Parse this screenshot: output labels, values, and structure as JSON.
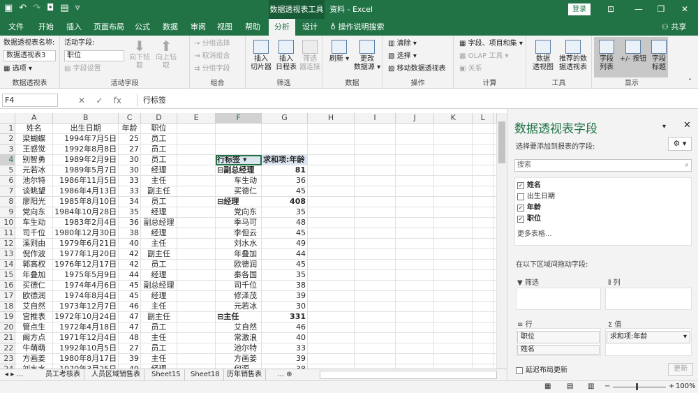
{
  "titlebar": {
    "context_tool": "数据透视表工具",
    "title": "资料 - Excel",
    "login": "登录"
  },
  "tabs": [
    "文件",
    "开始",
    "插入",
    "页面布局",
    "公式",
    "数据",
    "审阅",
    "视图",
    "帮助",
    "分析",
    "设计"
  ],
  "active_tab": "分析",
  "tell_me": "操作说明搜索",
  "share": "共享",
  "ribbon": {
    "pt_name_label": "数据透视表名称:",
    "pt_name_value": "数据透视表3",
    "options": "选项",
    "group_pivottable": "数据透视表",
    "active_field_label": "活动字段:",
    "active_field_value": "职位",
    "field_settings": "字段设置",
    "drill_down": "向下钻取",
    "drill_up": "向上钻",
    "drill_up2": "取",
    "group_active_field": "活动字段",
    "group_selection": "分组选择",
    "ungroup": "取消组合",
    "group_field": "分组字段",
    "group_group": "组合",
    "insert_slicer": "插入",
    "insert_slicer2": "切片器",
    "insert_timeline": "插入",
    "insert_timeline2": "日程表",
    "filter_conn": "筛选",
    "filter_conn2": "器连接",
    "group_filter": "筛选",
    "refresh": "刷新",
    "change_source": "更改",
    "change_source2": "数据源",
    "group_data": "数据",
    "clear": "清除",
    "select": "选择",
    "move_pt": "移动数据透视表",
    "group_actions": "操作",
    "fields_items_sets": "字段、项目和集",
    "olap_tools": "OLAP 工具",
    "relationships": "关系",
    "group_calc": "计算",
    "pivotchart": "数据",
    "pivotchart2": "透视图",
    "recommended": "推荐的数",
    "recommended2": "据透视表",
    "group_tools": "工具",
    "field_list": "字段",
    "field_list2": "列表",
    "pm_buttons": "+/- 按钮",
    "field_headers": "字段",
    "field_headers2": "标题",
    "group_show": "显示"
  },
  "namebox": "F4",
  "formula": "行标签",
  "columns": [
    "A",
    "B",
    "C",
    "D",
    "E",
    "F",
    "G",
    "H",
    "I",
    "J",
    "K",
    "L"
  ],
  "source_header": [
    "姓名",
    "出生日期",
    "年龄",
    "职位"
  ],
  "source_rows": [
    [
      "梁蝴蝶",
      "1994年7月5日",
      "25",
      "员工"
    ],
    [
      "王感觉",
      "1992年8月8日",
      "27",
      "员工"
    ],
    [
      "别智勇",
      "1989年2月9日",
      "30",
      "员工"
    ],
    [
      "元若冰",
      "1989年5月7日",
      "30",
      "经理"
    ],
    [
      "池尔特",
      "1986年11月5日",
      "33",
      "主任"
    ],
    [
      "谈眺望",
      "1986年4月13日",
      "33",
      "副主任"
    ],
    [
      "廖阳光",
      "1985年8月10日",
      "34",
      "员工"
    ],
    [
      "党向东",
      "1984年10月28日",
      "35",
      "经理"
    ],
    [
      "车生动",
      "1983年2月4日",
      "36",
      "副总经理"
    ],
    [
      "司千位",
      "1980年12月30日",
      "38",
      "经理"
    ],
    [
      "溪则由",
      "1979年6月21日",
      "40",
      "主任"
    ],
    [
      "倪作波",
      "1977年1月20日",
      "42",
      "副主任"
    ],
    [
      "郭高权",
      "1976年12月17日",
      "42",
      "员工"
    ],
    [
      "年叠加",
      "1975年5月9日",
      "44",
      "经理"
    ],
    [
      "买德仁",
      "1974年4月6日",
      "45",
      "副总经理"
    ],
    [
      "欧德润",
      "1974年8月4日",
      "45",
      "经理"
    ],
    [
      "艾自然",
      "1973年12月7日",
      "46",
      "主任"
    ],
    [
      "宫推表",
      "1972年10月24日",
      "47",
      "副主任"
    ],
    [
      "管点生",
      "1972年4月18日",
      "47",
      "员工"
    ],
    [
      "阚方点",
      "1971年12月4日",
      "48",
      "主任"
    ],
    [
      "牛萌萌",
      "1992年10月5日",
      "27",
      "员工"
    ],
    [
      "方画姜",
      "1980年8月17日",
      "39",
      "主任"
    ],
    [
      "刘水水",
      "1970年3月25日",
      "49",
      "经理"
    ]
  ],
  "pivot": {
    "row_label": "行标签",
    "value_label": "求和项:年龄",
    "rows": [
      {
        "label": "副总经理",
        "value": "81",
        "group": true
      },
      {
        "label": "车生动",
        "value": "36"
      },
      {
        "label": "买德仁",
        "value": "45"
      },
      {
        "label": "经理",
        "value": "408",
        "group": true
      },
      {
        "label": "党向东",
        "value": "35"
      },
      {
        "label": "季马可",
        "value": "48"
      },
      {
        "label": "李但云",
        "value": "45"
      },
      {
        "label": "刘水水",
        "value": "49"
      },
      {
        "label": "年叠加",
        "value": "44"
      },
      {
        "label": "欧德润",
        "value": "45"
      },
      {
        "label": "秦各国",
        "value": "35"
      },
      {
        "label": "司千位",
        "value": "38"
      },
      {
        "label": "修泽茂",
        "value": "39"
      },
      {
        "label": "元若冰",
        "value": "30"
      },
      {
        "label": "主任",
        "value": "331",
        "group": true
      },
      {
        "label": "艾自然",
        "value": "46"
      },
      {
        "label": "常激浪",
        "value": "40"
      },
      {
        "label": "池尔特",
        "value": "33"
      },
      {
        "label": "方画姜",
        "value": "39"
      },
      {
        "label": "何源",
        "value": "38"
      }
    ]
  },
  "sheet_tabs": [
    "员工考核表",
    "人员区域销售表",
    "Sheet15",
    "Sheet18",
    "历年销售表"
  ],
  "zoom": "100%",
  "pane": {
    "title": "数据透视表字段",
    "choose": "选择要添加到报表的字段:",
    "search": "搜索",
    "fields": [
      {
        "name": "姓名",
        "checked": true
      },
      {
        "name": "出生日期",
        "checked": false
      },
      {
        "name": "年龄",
        "checked": true
      },
      {
        "name": "职位",
        "checked": true
      }
    ],
    "more_tables": "更多表格...",
    "drag_hint": "在以下区域间拖动字段:",
    "filters": "筛选",
    "cols": "列",
    "rows": "行",
    "values": "值",
    "row_chip1": "职位",
    "row_chip2": "姓名",
    "value_chip": "求和项:年龄",
    "defer": "延迟布局更新",
    "update": "更新"
  }
}
